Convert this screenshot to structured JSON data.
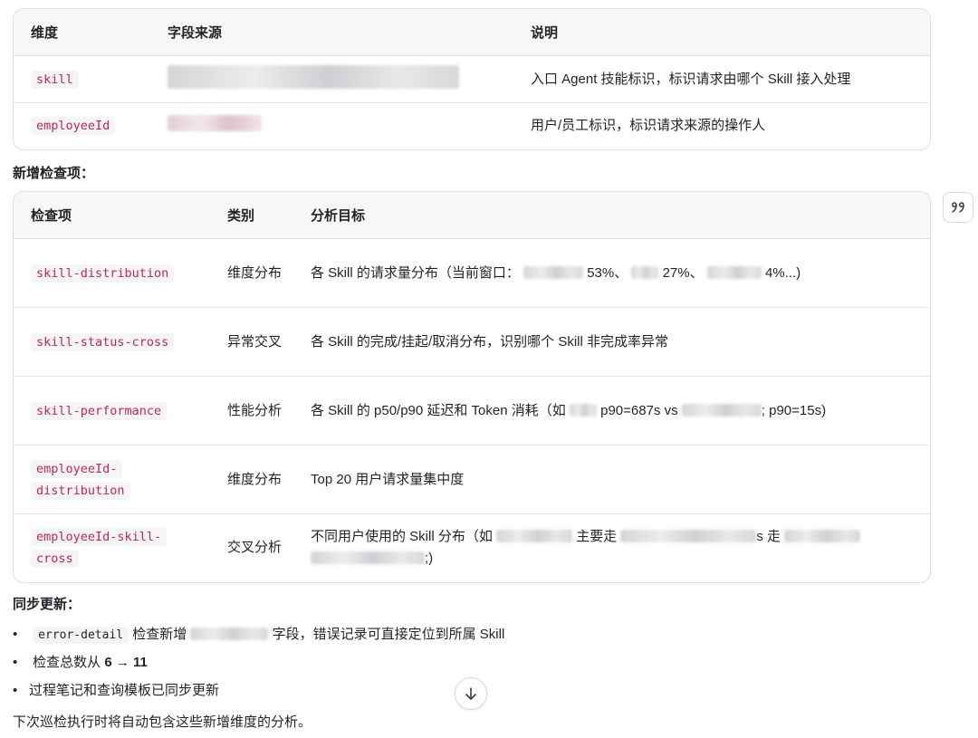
{
  "table1": {
    "headers": [
      "维度",
      "字段来源",
      "说明"
    ],
    "rows": [
      {
        "dim": "skill",
        "desc": "入口 Agent 技能标识，标识请求由哪个 Skill 接入处理"
      },
      {
        "dim": "employeeId",
        "desc": "用户/员工标识，标识请求来源的操作人"
      }
    ]
  },
  "new_checks_heading": "新增检查项：",
  "table2": {
    "headers": [
      "检查项",
      "类别",
      "分析目标"
    ],
    "rows": [
      {
        "item": "skill-distribution",
        "category": "维度分布",
        "target": {
          "a": "各 Skill 的请求量分布（当前窗口：",
          "b": "53%、",
          "c": "27%、",
          "d": "4%...)"
        }
      },
      {
        "item": "skill-status-cross",
        "category": "异常交叉",
        "target": {
          "a": "各 Skill 的完成/挂起/取消分布，识别哪个 Skill 非完成率异常"
        }
      },
      {
        "item": "skill-performance",
        "category": "性能分析",
        "target": {
          "a": "各 Skill 的 p50/p90 延迟和 Token 消耗（如",
          "b": "p90=687s vs",
          "c": "; p90=15s)"
        }
      },
      {
        "item": "employeeId-distribution",
        "category": "维度分布",
        "target": {
          "a": "Top 20 用户请求量集中度"
        }
      },
      {
        "item": "employeeId-skill-cross",
        "category": "交叉分析",
        "target": {
          "a": "不同用户使用的 Skill 分布（如",
          "b": "主要走",
          "c": "s 走",
          "d": ";)"
        }
      }
    ]
  },
  "sync_heading": "同步更新：",
  "bullets": {
    "b1_code": "error-detail",
    "b1_a": "检查新增",
    "b1_b": "字段，错误记录可直接定位到所属 Skill",
    "b2_a": "检查总数从",
    "b2_bold": "6 → 11",
    "b3": "过程笔记和查询模板已同步更新"
  },
  "footer": "下次巡检执行时将自动包含这些新增维度的分析。",
  "icons": {
    "scroll": "arrow-down-icon",
    "quote": "quote-icon"
  },
  "colors": {
    "code_red": "#c7254e",
    "border": "#dcdfe4",
    "header_bg": "#f7f7f8"
  }
}
